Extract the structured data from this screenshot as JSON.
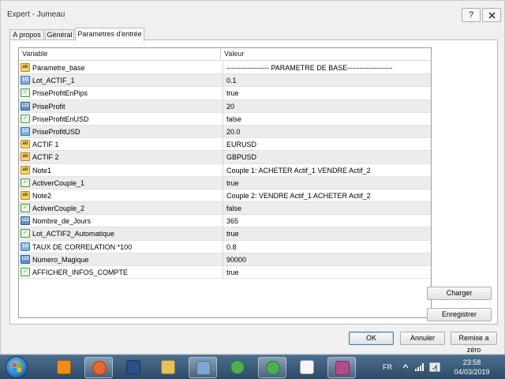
{
  "window": {
    "title": "Expert - Jumeau",
    "help_glyph": "?",
    "close_glyph": "X"
  },
  "tabs": [
    {
      "label": "A propos"
    },
    {
      "label": "Général"
    },
    {
      "label": "Parametres d'entrée"
    }
  ],
  "grid": {
    "col_variable": "Variable",
    "col_value": "Valeur",
    "rows": [
      {
        "icon": "ab",
        "name": "Parametre_base",
        "value": "------------------ PARAMETRE DE BASE-------------------"
      },
      {
        "icon": "dbl",
        "name": "Lot_ACTIF_1",
        "value": "0.1"
      },
      {
        "icon": "bool",
        "name": "PriseProfitEnPips",
        "value": "true"
      },
      {
        "icon": "num",
        "name": "PriseProfit",
        "value": "20"
      },
      {
        "icon": "bool",
        "name": "PriseProfitEnUSD",
        "value": "false"
      },
      {
        "icon": "dbl",
        "name": "PriseProfitUSD",
        "value": "20.0"
      },
      {
        "icon": "ab",
        "name": "ACTIF 1",
        "value": "EURUSD"
      },
      {
        "icon": "ab",
        "name": "ACTIF 2",
        "value": "GBPUSD"
      },
      {
        "icon": "ab",
        "name": "Note1",
        "value": "Couple 1: ACHETER Actif_1 VENDRE Actif_2"
      },
      {
        "icon": "bool",
        "name": "ActiverCouple_1",
        "value": "true"
      },
      {
        "icon": "ab",
        "name": "Note2",
        "value": "Couple 2: VENDRE Actif_1 ACHETER Actif_2"
      },
      {
        "icon": "bool",
        "name": "ActiverCouple_2",
        "value": "false"
      },
      {
        "icon": "num",
        "name": "Nombre_de_Jours",
        "value": "365"
      },
      {
        "icon": "bool",
        "name": "Lot_ACTIF2_Automatique",
        "value": "true"
      },
      {
        "icon": "dbl",
        "name": "TAUX DE CORRELATION *100",
        "value": "0.8"
      },
      {
        "icon": "num",
        "name": "Numero_Magique",
        "value": "90000"
      },
      {
        "icon": "bool",
        "name": "AFFICHER_INFOS_COMPTE",
        "value": "true"
      }
    ]
  },
  "buttons": {
    "charger": "Charger",
    "enregistrer": "Enregistrer",
    "ok": "OK",
    "annuler": "Annuler",
    "reset": "Remise a zéro"
  },
  "icon_glyphs": {
    "ab": "ab",
    "num": "123",
    "dbl": "1/2",
    "bool": "✓"
  },
  "taskbar": {
    "language": "FR",
    "time": "23:58",
    "date": "04/03/2019",
    "apps": [
      {
        "name": "vlc-icon",
        "color": "#f28c18"
      },
      {
        "name": "firefox-icon",
        "color": "#e8672c"
      },
      {
        "name": "devexpress-icon",
        "color": "#2b4f8a"
      },
      {
        "name": "file-explorer-icon",
        "color": "#e6c25a"
      },
      {
        "name": "control-panel-icon",
        "color": "#7ba7d6"
      },
      {
        "name": "metatrader-icon-1",
        "color": "#4caf50"
      },
      {
        "name": "metatrader-icon-2",
        "color": "#4caf50"
      },
      {
        "name": "notepad-icon",
        "color": "#f4f4f4"
      },
      {
        "name": "winrar-icon",
        "color": "#b34b8c"
      }
    ]
  }
}
